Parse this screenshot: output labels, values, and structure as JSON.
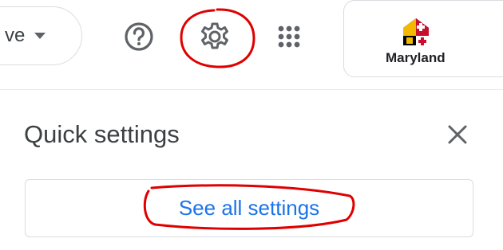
{
  "header": {
    "status_label": "ve",
    "help_icon": "help-circle-icon",
    "settings_icon": "gear-icon",
    "apps_icon": "apps-grid-icon",
    "account": {
      "org_name": "Maryland"
    }
  },
  "quick_settings": {
    "title": "Quick settings",
    "close_icon": "close-icon",
    "see_all_label": "See all settings"
  },
  "colors": {
    "accent": "#1a73e8",
    "annotation": "#e00000",
    "border": "#dadce0",
    "icon": "#5f6368",
    "text": "#3c4043"
  }
}
